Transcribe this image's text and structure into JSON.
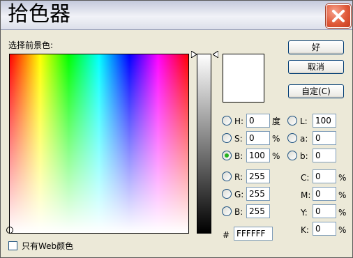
{
  "window": {
    "title": "拾色器"
  },
  "picker": {
    "prompt": "选择前景色:"
  },
  "buttons": {
    "ok": "好",
    "cancel": "取消",
    "custom": "自定(C)"
  },
  "hsb": {
    "h": {
      "label": "H:",
      "value": "0",
      "unit": "度"
    },
    "s": {
      "label": "S:",
      "value": "0",
      "unit": "%"
    },
    "b": {
      "label": "B:",
      "value": "100",
      "unit": "%"
    },
    "selected": "B"
  },
  "lab": {
    "l": {
      "label": "L:",
      "value": "100"
    },
    "a": {
      "label": "a:",
      "value": "0"
    },
    "b": {
      "label": "b:",
      "value": "0"
    }
  },
  "rgb": {
    "r": {
      "label": "R:",
      "value": "255"
    },
    "g": {
      "label": "G:",
      "value": "255"
    },
    "b": {
      "label": "B:",
      "value": "255"
    }
  },
  "cmyk": {
    "c": {
      "label": "C:",
      "value": "0",
      "unit": "%"
    },
    "m": {
      "label": "M:",
      "value": "0",
      "unit": "%"
    },
    "y": {
      "label": "Y:",
      "value": "0",
      "unit": "%"
    },
    "k": {
      "label": "K:",
      "value": "0",
      "unit": "%"
    }
  },
  "hex": {
    "label": "#",
    "value": "FFFFFF"
  },
  "web_only": {
    "label": "只有Web颜色",
    "checked": false
  },
  "colors": {
    "current": "#ffffff",
    "radio_check": "#24b21f"
  },
  "icons": {
    "close": "close-x-icon",
    "slider": "slider-triangle-icon"
  }
}
